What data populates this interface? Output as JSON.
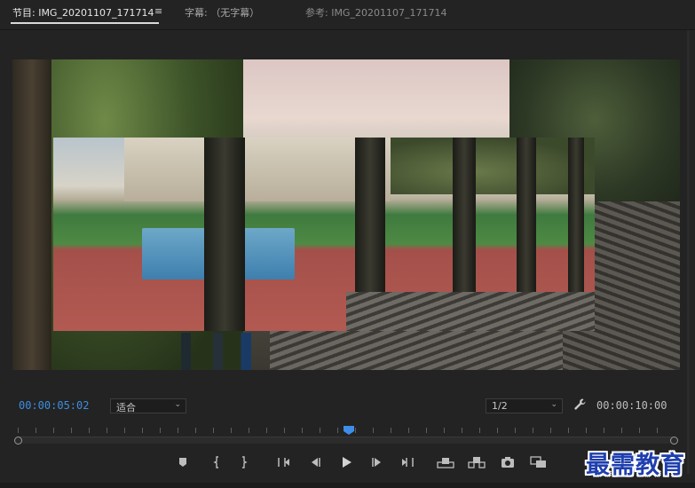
{
  "tabs": {
    "program": "节目: IMG_20201107_171714",
    "menu_glyph": "≡",
    "captions": "字幕: （无字幕）",
    "source": "参考: IMG_20201107_171714"
  },
  "playback": {
    "current_timecode": "00:00:05:02",
    "duration_timecode": "00:00:10:00",
    "zoom": "适合",
    "resolution": "1/2",
    "playhead_fraction": 0.5
  },
  "transport_icons": [
    "add-marker-icon",
    "mark-in-icon",
    "mark-out-icon",
    "go-to-in-icon",
    "step-back-icon",
    "play-icon",
    "step-forward-icon",
    "go-to-out-icon",
    "lift-icon",
    "extract-icon",
    "export-frame-icon",
    "comparison-view-icon"
  ],
  "watermark": "最需教育",
  "colors": {
    "accent": "#3d8ee8",
    "background": "#232323",
    "watermark": "#1f3fae"
  }
}
